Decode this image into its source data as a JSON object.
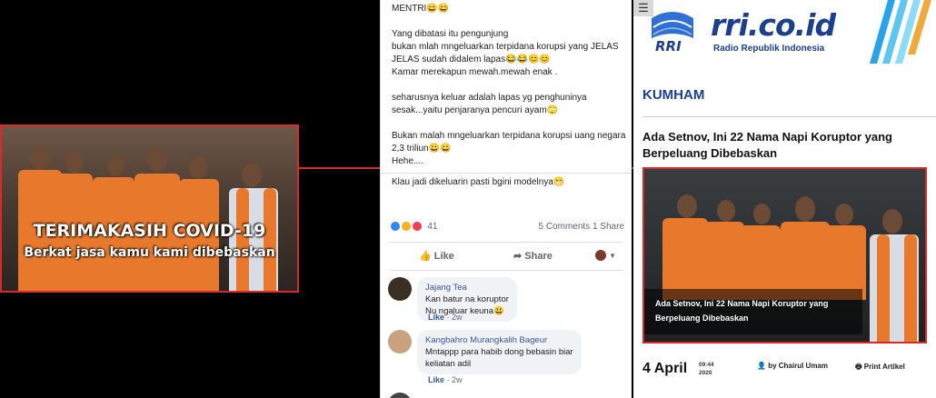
{
  "left_image": {
    "caption_main": "TERIMAKASIH COVID-19",
    "caption_sub": "Berkat jasa kamu kami dibebaskan"
  },
  "facebook": {
    "post_text": "MENTRI😄😄\n\nYang dibatasi itu pengunjung\nbukan mlah mngeluarkan terpidana korupsi yang JELAS JELAS sudah didalem lapas😂😂😊😊\nKamar merekapun mewah.mewah enak .\n\nseharusnya keluar adalah lapas yg penghuninya sesak...yaitu penjaranya pencuri ayam🙄\n\nBukan malah mngeluarkan terpidana korupsi uang negara 2,3 triliun😀😀\nHehe....",
    "post_text_2": "Klau jadi dikeluarin pasti bgini modelnya😁",
    "reaction_count": "41",
    "comments_count": "5 Comments",
    "shares_count": "1 Share",
    "like_label": "Like",
    "share_label": "Share",
    "comments": [
      {
        "author": "Jajang Tea",
        "text": "Kan batur na koruptor\nNu ngaluar keuna😃",
        "like": "Like",
        "time": "2w"
      },
      {
        "author": "Kangbahro Murangkalih Bageur",
        "text": "Mntappp para habib dong bebasin biar\nkeliatan adil",
        "like": "Like",
        "time": "2w"
      }
    ]
  },
  "rri": {
    "logo_text": "rri.co.id",
    "logo_sub": "Radio Republik Indonesia",
    "logo_badge": "RRI",
    "section": "KUMHAM",
    "headline": "Ada Setnov, Ini 22 Nama Napi Koruptor yang Berpeluang Dibebaskan",
    "photo_caption": "Ada Setnov, Ini 22 Nama Napi Koruptor yang Berpeluang Dibebaskan",
    "date": "4 April",
    "time_year": "09:44\n2020",
    "byline": "by Chairul Umam",
    "print_label": "Print Artikel"
  }
}
